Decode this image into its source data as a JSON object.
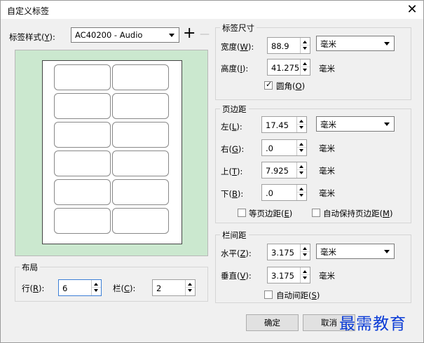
{
  "window": {
    "title": "自定义标签",
    "close_glyph": "✕"
  },
  "label_style": {
    "label": "标签样式(",
    "key": "Y",
    "suffix": "):",
    "value": "AC40200 - Audio",
    "add_glyph": "+",
    "remove_glyph": "—"
  },
  "label_size": {
    "group": "标签尺寸",
    "width_label": "宽度(",
    "width_key": "W",
    "width_value": "88.9",
    "unit_combo": "毫米",
    "height_label": "高度(",
    "height_key": "I",
    "height_value": "41.275",
    "height_unit": "毫米",
    "rounded_label": "圆角(",
    "rounded_key": "O",
    "rounded_checked": true
  },
  "margins": {
    "group": "页边距",
    "left_label": "左(",
    "left_key": "L",
    "left_value": "17.45",
    "unit_combo": "毫米",
    "right_label": "右(",
    "right_key": "G",
    "right_value": ".0",
    "right_unit": "毫米",
    "top_label": "上(",
    "top_key": "T",
    "top_value": "7.925",
    "top_unit": "毫米",
    "bottom_label": "下(",
    "bottom_key": "B",
    "bottom_value": ".0",
    "bottom_unit": "毫米",
    "equal_label": "等页边距(",
    "equal_key": "E",
    "auto_label": "自动保持页边距(",
    "auto_key": "M"
  },
  "gutter": {
    "group": "栏间距",
    "horiz_label": "水平(",
    "horiz_key": "Z",
    "horiz_value": "3.175",
    "unit_combo": "毫米",
    "vert_label": "垂直(",
    "vert_key": "V",
    "vert_value": "3.175",
    "vert_unit": "毫米",
    "auto_label": "自动间距(",
    "auto_key": "S"
  },
  "layout": {
    "group": "布局",
    "rows_label": "行(",
    "rows_key": "R",
    "rows_value": "6",
    "cols_label": "栏(",
    "cols_key": "C",
    "cols_value": "2"
  },
  "preview": {
    "rows": 6,
    "cols": 2
  },
  "buttons": {
    "ok": "确定",
    "cancel": "取消"
  },
  "watermark": "最需教育",
  "colors": {
    "preview_bg": "#cbe8cf",
    "watermark": "#0a3bd6"
  }
}
